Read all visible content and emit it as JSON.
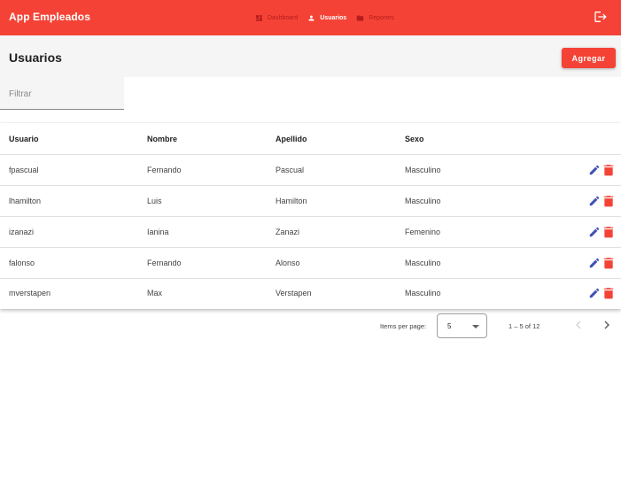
{
  "app": {
    "title": "App Empleados"
  },
  "nav": {
    "items": [
      {
        "label": "Dashboard",
        "icon": "dashboard-icon",
        "active": false
      },
      {
        "label": "Usuarios",
        "icon": "person-icon",
        "active": true
      },
      {
        "label": "Reportes",
        "icon": "folder-icon",
        "active": false
      }
    ]
  },
  "page": {
    "title": "Usuarios",
    "add_label": "Agregar"
  },
  "filter": {
    "placeholder": "Filtrar",
    "value": ""
  },
  "table": {
    "columns": [
      "Usuario",
      "Nombre",
      "Apellido",
      "Sexo"
    ],
    "rows": [
      {
        "usuario": "fpascual",
        "nombre": "Fernando",
        "apellido": "Pascual",
        "sexo": "Masculino"
      },
      {
        "usuario": "lhamilton",
        "nombre": "Luis",
        "apellido": "Hamilton",
        "sexo": "Masculino"
      },
      {
        "usuario": "izanazi",
        "nombre": "Ianina",
        "apellido": "Zanazi",
        "sexo": "Femenino"
      },
      {
        "usuario": "falonso",
        "nombre": "Fernando",
        "apellido": "Alonso",
        "sexo": "Masculino"
      },
      {
        "usuario": "mverstapen",
        "nombre": "Max",
        "apellido": "Verstapen",
        "sexo": "Masculino"
      }
    ]
  },
  "paginator": {
    "items_per_page_label": "Items per page:",
    "page_size": "5",
    "range_label": "1 – 5 of 12"
  },
  "colors": {
    "primary": "#f44336",
    "accent": "#3f51b5",
    "header_bg": "#f5f5f5"
  }
}
